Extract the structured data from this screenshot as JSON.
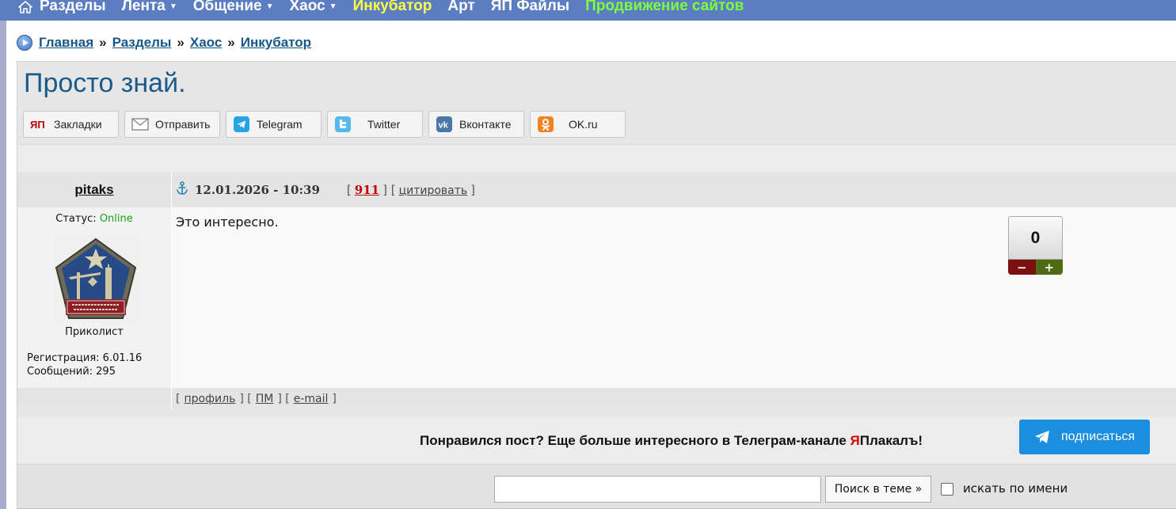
{
  "nav": {
    "items": [
      {
        "label": "Разделы",
        "caret": false
      },
      {
        "label": "Лента",
        "caret": true
      },
      {
        "label": "Общение",
        "caret": true
      },
      {
        "label": "Хаос",
        "caret": true
      },
      {
        "label": "Инкубатор",
        "caret": false
      },
      {
        "label": "Арт",
        "caret": false
      },
      {
        "label": "ЯП Файлы",
        "caret": false
      },
      {
        "label": "Продвижение сайтов",
        "caret": false
      }
    ],
    "caret_glyph": "▼"
  },
  "breadcrumb": {
    "items": [
      "Главная",
      "Разделы",
      "Хаос",
      "Инкубатор"
    ],
    "separator": "»"
  },
  "topic": {
    "title": "Просто знай."
  },
  "share": {
    "buttons": [
      {
        "label": "Закладки",
        "icon": "yap-icon"
      },
      {
        "label": "Отправить",
        "icon": "envelope-icon"
      },
      {
        "label": "Telegram",
        "icon": "telegram-icon"
      },
      {
        "label": "Twitter",
        "icon": "twitter-icon"
      },
      {
        "label": "Вконтакте",
        "icon": "vk-icon"
      },
      {
        "label": "OK.ru",
        "icon": "ok-icon"
      }
    ]
  },
  "post": {
    "author": "pitaks",
    "status_label": "Статус:",
    "status_value": "Online",
    "rank": "Приколист",
    "registration": "Регистрация: 6.01.16",
    "messages": "Сообщений: 295",
    "date": "12.01.2026 - 10:39",
    "post_number": "911",
    "quote_label": "цитировать",
    "text": "Это интересно.",
    "rating": "0",
    "rating_minus": "−",
    "rating_plus": "+",
    "footer_links": [
      "профиль",
      "ПМ",
      "e-mail"
    ]
  },
  "promo": {
    "text_before": "Понравился пост? Еще больше интересного в Телеграм-канале ",
    "brand_red": "Я",
    "brand_rest": "Плакалъ!",
    "subscribe_label": "подписаться"
  },
  "search": {
    "input_value": "",
    "button_label": "Поиск в теме »",
    "checkbox_label": "искать по имени",
    "checkbox_checked": false
  },
  "colors": {
    "nav_bg": "#5b7ec2",
    "link": "#175688",
    "title": "#1a5b8c",
    "online": "#1a9e1a",
    "subscribe": "#1c8ee0"
  }
}
